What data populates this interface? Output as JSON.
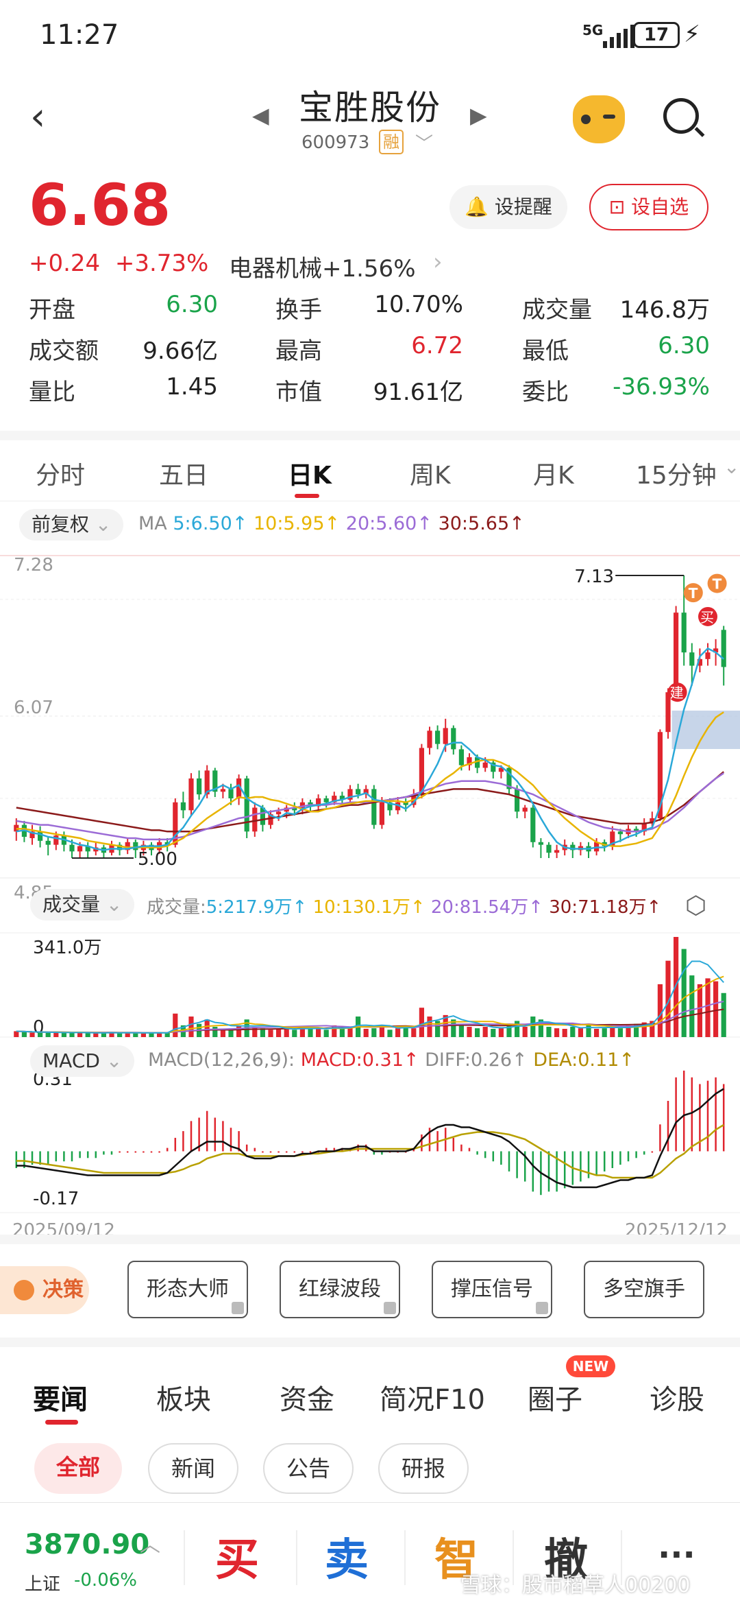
{
  "status": {
    "time": "11:27",
    "network": "5G",
    "battery": "17"
  },
  "header": {
    "title": "宝胜股份",
    "code": "600973",
    "rong": "融",
    "back_icon": "back-arrow-icon",
    "mascot_icon": "mascot-icon",
    "search_icon": "search-icon"
  },
  "quote": {
    "price": "6.68",
    "change": "+0.24",
    "pct": "+3.73%",
    "sector": "电器机械+1.56%",
    "alert_btn": "设提醒",
    "fav_btn": "设自选",
    "stats": [
      {
        "k": "开盘",
        "v": "6.30",
        "c": "green"
      },
      {
        "k": "换手",
        "v": "10.70%",
        "c": "dark"
      },
      {
        "k": "成交量",
        "v": "146.8万",
        "c": "dark"
      },
      {
        "k": "成交额",
        "v": "9.66亿",
        "c": "dark"
      },
      {
        "k": "最高",
        "v": "6.72",
        "c": "red"
      },
      {
        "k": "最低",
        "v": "6.30",
        "c": "green"
      },
      {
        "k": "量比",
        "v": "1.45",
        "c": "dark"
      },
      {
        "k": "市值",
        "v": "91.61亿",
        "c": "dark"
      },
      {
        "k": "委比",
        "v": "-36.93%",
        "c": "green"
      }
    ]
  },
  "tabs": [
    "分时",
    "五日",
    "日K",
    "周K",
    "月K",
    "15分钟"
  ],
  "active_tab": "日K",
  "indicators": {
    "fq": "前复权",
    "ma_label": "MA",
    "ma5": "5:6.50↑",
    "ma10": "10:5.95↑",
    "ma20": "20:5.60↑",
    "ma30": "30:5.65↑",
    "vol_btn": "成交量",
    "vol_label": "成交量:",
    "vol5": "5:217.9万↑",
    "vol10": "10:130.1万↑",
    "vol20": "20:81.54万↑",
    "vol30": "30:71.18万↑",
    "macd_btn": "MACD",
    "macd_params": "MACD(12,26,9):",
    "macd": "MACD:0.31↑",
    "diff": "DIFF:0.26↑",
    "dea": "DEA:0.11↑"
  },
  "chart_data": {
    "type": "candlestick",
    "price_axis": {
      "top": "7.28",
      "mid": "6.07",
      "bottom": "4.85"
    },
    "annotations": {
      "high": "7.13",
      "low": "5.00",
      "buy": "买",
      "build": "建",
      "t": "T"
    },
    "volume_axis": {
      "top": "341.0万",
      "zero": "0"
    },
    "macd_axis": {
      "top": "0.31",
      "bottom": "-0.17"
    },
    "x_start": "2025/09/12",
    "x_end": "2025/12/12",
    "colors": {
      "up": "#e0252e",
      "down": "#1aa34a",
      "ma5": "#2aa8d8",
      "ma10": "#e8b400",
      "ma20": "#9b6bd6",
      "ma30": "#8b1a1a"
    },
    "candles": [
      [
        5.2,
        5.25,
        5.13,
        5.3
      ],
      [
        5.25,
        5.16,
        5.12,
        5.28
      ],
      [
        5.15,
        5.2,
        5.1,
        5.25
      ],
      [
        5.2,
        5.13,
        5.08,
        5.24
      ],
      [
        5.13,
        5.1,
        5.02,
        5.16
      ],
      [
        5.1,
        5.17,
        5.06,
        5.2
      ],
      [
        5.17,
        5.1,
        5.05,
        5.2
      ],
      [
        5.1,
        5.05,
        5.0,
        5.14
      ],
      [
        5.05,
        5.09,
        5.0,
        5.12
      ],
      [
        5.09,
        5.05,
        5.0,
        5.12
      ],
      [
        5.05,
        5.08,
        5.02,
        5.12
      ],
      [
        5.08,
        5.04,
        5.0,
        5.1
      ],
      [
        5.04,
        5.1,
        5.02,
        5.13
      ],
      [
        5.1,
        5.06,
        5.02,
        5.12
      ],
      [
        5.06,
        5.12,
        5.03,
        5.15
      ],
      [
        5.12,
        5.06,
        5.0,
        5.14
      ],
      [
        5.06,
        5.1,
        5.02,
        5.13
      ],
      [
        5.1,
        5.06,
        5.02,
        5.12
      ],
      [
        5.06,
        5.12,
        5.03,
        5.15
      ],
      [
        5.12,
        5.1,
        5.05,
        5.15
      ],
      [
        5.1,
        5.42,
        5.08,
        5.45
      ],
      [
        5.42,
        5.36,
        5.3,
        5.5
      ],
      [
        5.36,
        5.6,
        5.32,
        5.64
      ],
      [
        5.6,
        5.48,
        5.44,
        5.66
      ],
      [
        5.48,
        5.66,
        5.45,
        5.7
      ],
      [
        5.66,
        5.5,
        5.46,
        5.68
      ],
      [
        5.5,
        5.52,
        5.45,
        5.56
      ],
      [
        5.52,
        5.45,
        5.4,
        5.56
      ],
      [
        5.45,
        5.6,
        5.4,
        5.63
      ],
      [
        5.6,
        5.2,
        5.15,
        5.62
      ],
      [
        5.2,
        5.38,
        5.16,
        5.42
      ],
      [
        5.38,
        5.25,
        5.2,
        5.4
      ],
      [
        5.25,
        5.33,
        5.22,
        5.36
      ],
      [
        5.33,
        5.35,
        5.28,
        5.38
      ],
      [
        5.35,
        5.38,
        5.3,
        5.4
      ],
      [
        5.38,
        5.36,
        5.32,
        5.42
      ],
      [
        5.36,
        5.42,
        5.33,
        5.45
      ],
      [
        5.42,
        5.39,
        5.35,
        5.44
      ],
      [
        5.39,
        5.45,
        5.36,
        5.48
      ],
      [
        5.45,
        5.42,
        5.38,
        5.47
      ],
      [
        5.42,
        5.47,
        5.4,
        5.5
      ],
      [
        5.47,
        5.44,
        5.4,
        5.5
      ],
      [
        5.44,
        5.52,
        5.42,
        5.55
      ],
      [
        5.52,
        5.48,
        5.45,
        5.56
      ],
      [
        5.48,
        5.52,
        5.45,
        5.55
      ],
      [
        5.52,
        5.25,
        5.22,
        5.55
      ],
      [
        5.25,
        5.42,
        5.22,
        5.46
      ],
      [
        5.42,
        5.36,
        5.32,
        5.45
      ],
      [
        5.36,
        5.42,
        5.33,
        5.46
      ],
      [
        5.42,
        5.4,
        5.35,
        5.45
      ],
      [
        5.4,
        5.48,
        5.38,
        5.52
      ],
      [
        5.48,
        5.83,
        5.45,
        5.86
      ],
      [
        5.83,
        5.96,
        5.78,
        5.99
      ],
      [
        5.96,
        5.86,
        5.82,
        6.0
      ],
      [
        5.86,
        5.98,
        5.8,
        6.05
      ],
      [
        5.98,
        5.82,
        5.78,
        6.0
      ],
      [
        5.82,
        5.7,
        5.66,
        5.85
      ],
      [
        5.7,
        5.76,
        5.66,
        5.79
      ],
      [
        5.76,
        5.68,
        5.64,
        5.78
      ],
      [
        5.68,
        5.72,
        5.65,
        5.76
      ],
      [
        5.72,
        5.65,
        5.6,
        5.74
      ],
      [
        5.65,
        5.68,
        5.6,
        5.7
      ],
      [
        5.68,
        5.52,
        5.48,
        5.7
      ],
      [
        5.52,
        5.35,
        5.3,
        5.55
      ],
      [
        5.35,
        5.38,
        5.3,
        5.4
      ],
      [
        5.38,
        5.12,
        5.08,
        5.4
      ],
      [
        5.12,
        5.1,
        5.0,
        5.15
      ],
      [
        5.1,
        5.04,
        5.0,
        5.12
      ],
      [
        5.04,
        5.06,
        5.0,
        5.1
      ],
      [
        5.06,
        5.1,
        5.02,
        5.14
      ],
      [
        5.1,
        5.06,
        5.0,
        5.12
      ],
      [
        5.06,
        5.09,
        5.02,
        5.12
      ],
      [
        5.09,
        5.05,
        5.0,
        5.12
      ],
      [
        5.05,
        5.12,
        5.02,
        5.15
      ],
      [
        5.12,
        5.09,
        5.05,
        5.14
      ],
      [
        5.09,
        5.2,
        5.06,
        5.24
      ],
      [
        5.2,
        5.18,
        5.12,
        5.22
      ],
      [
        5.18,
        5.22,
        5.15,
        5.25
      ],
      [
        5.22,
        5.2,
        5.16,
        5.24
      ],
      [
        5.2,
        5.26,
        5.17,
        5.3
      ],
      [
        5.26,
        5.3,
        5.22,
        5.35
      ],
      [
        5.3,
        5.95,
        5.28,
        5.97
      ],
      [
        5.95,
        6.25,
        5.9,
        6.28
      ],
      [
        6.25,
        6.85,
        6.2,
        6.9
      ],
      [
        6.85,
        6.55,
        6.45,
        7.13
      ],
      [
        6.55,
        6.45,
        6.3,
        6.62
      ],
      [
        6.45,
        6.5,
        6.4,
        6.58
      ],
      [
        6.5,
        6.55,
        6.45,
        6.62
      ],
      [
        6.55,
        6.58,
        6.45,
        6.65
      ],
      [
        6.72,
        6.44,
        6.3,
        6.75
      ]
    ],
    "ma5": [
      5.2,
      5.21,
      5.19,
      5.18,
      5.16,
      5.15,
      5.14,
      5.12,
      5.1,
      5.09,
      5.07,
      5.06,
      5.07,
      5.07,
      5.07,
      5.08,
      5.09,
      5.09,
      5.09,
      5.1,
      5.17,
      5.23,
      5.32,
      5.4,
      5.5,
      5.52,
      5.55,
      5.52,
      5.55,
      5.45,
      5.41,
      5.38,
      5.32,
      5.3,
      5.34,
      5.33,
      5.37,
      5.39,
      5.4,
      5.41,
      5.43,
      5.44,
      5.46,
      5.47,
      5.49,
      5.44,
      5.43,
      5.41,
      5.4,
      5.37,
      5.42,
      5.5,
      5.6,
      5.71,
      5.85,
      5.87,
      5.87,
      5.82,
      5.76,
      5.74,
      5.7,
      5.69,
      5.64,
      5.58,
      5.5,
      5.41,
      5.3,
      5.2,
      5.12,
      5.08,
      5.07,
      5.07,
      5.07,
      5.08,
      5.08,
      5.11,
      5.13,
      5.16,
      5.18,
      5.21,
      5.23,
      5.39,
      5.59,
      5.87,
      6.12,
      6.31,
      6.52,
      6.58,
      6.55,
      6.5
    ],
    "ma10": [
      5.22,
      5.22,
      5.21,
      5.2,
      5.19,
      5.18,
      5.17,
      5.16,
      5.15,
      5.13,
      5.12,
      5.11,
      5.1,
      5.09,
      5.08,
      5.08,
      5.08,
      5.08,
      5.08,
      5.09,
      5.12,
      5.15,
      5.2,
      5.25,
      5.3,
      5.34,
      5.38,
      5.42,
      5.46,
      5.45,
      5.46,
      5.46,
      5.44,
      5.43,
      5.41,
      5.39,
      5.37,
      5.35,
      5.35,
      5.37,
      5.38,
      5.4,
      5.41,
      5.42,
      5.43,
      5.43,
      5.43,
      5.43,
      5.43,
      5.42,
      5.44,
      5.46,
      5.5,
      5.55,
      5.6,
      5.64,
      5.69,
      5.71,
      5.73,
      5.74,
      5.74,
      5.72,
      5.69,
      5.65,
      5.6,
      5.55,
      5.48,
      5.42,
      5.36,
      5.3,
      5.25,
      5.2,
      5.16,
      5.12,
      5.1,
      5.09,
      5.09,
      5.1,
      5.11,
      5.13,
      5.15,
      5.24,
      5.34,
      5.47,
      5.62,
      5.76,
      5.88,
      5.98,
      6.06,
      6.1
    ],
    "ma20": [
      5.28,
      5.27,
      5.26,
      5.25,
      5.25,
      5.24,
      5.23,
      5.22,
      5.21,
      5.2,
      5.19,
      5.18,
      5.17,
      5.16,
      5.15,
      5.15,
      5.14,
      5.14,
      5.14,
      5.14,
      5.15,
      5.16,
      5.18,
      5.2,
      5.22,
      5.24,
      5.26,
      5.28,
      5.3,
      5.31,
      5.33,
      5.34,
      5.35,
      5.36,
      5.37,
      5.38,
      5.39,
      5.4,
      5.4,
      5.4,
      5.41,
      5.41,
      5.42,
      5.42,
      5.42,
      5.43,
      5.43,
      5.44,
      5.45,
      5.46,
      5.48,
      5.5,
      5.52,
      5.54,
      5.56,
      5.57,
      5.58,
      5.58,
      5.58,
      5.58,
      5.57,
      5.56,
      5.54,
      5.52,
      5.5,
      5.48,
      5.45,
      5.42,
      5.39,
      5.36,
      5.33,
      5.3,
      5.27,
      5.25,
      5.23,
      5.22,
      5.21,
      5.2,
      5.2,
      5.21,
      5.22,
      5.25,
      5.28,
      5.33,
      5.38,
      5.44,
      5.5,
      5.55,
      5.6,
      5.64
    ],
    "ma30": [
      5.38,
      5.37,
      5.36,
      5.35,
      5.34,
      5.33,
      5.32,
      5.31,
      5.3,
      5.29,
      5.28,
      5.27,
      5.26,
      5.25,
      5.24,
      5.23,
      5.22,
      5.21,
      5.21,
      5.2,
      5.2,
      5.2,
      5.2,
      5.21,
      5.22,
      5.23,
      5.24,
      5.25,
      5.26,
      5.27,
      5.28,
      5.29,
      5.3,
      5.31,
      5.32,
      5.33,
      5.34,
      5.35,
      5.36,
      5.37,
      5.38,
      5.39,
      5.4,
      5.4,
      5.41,
      5.42,
      5.43,
      5.44,
      5.45,
      5.46,
      5.47,
      5.48,
      5.49,
      5.5,
      5.51,
      5.52,
      5.52,
      5.52,
      5.52,
      5.51,
      5.5,
      5.49,
      5.48,
      5.46,
      5.44,
      5.42,
      5.4,
      5.38,
      5.36,
      5.34,
      5.32,
      5.31,
      5.3,
      5.29,
      5.28,
      5.27,
      5.26,
      5.26,
      5.26,
      5.26,
      5.27,
      5.29,
      5.32,
      5.36,
      5.4,
      5.45,
      5.5,
      5.55,
      5.6,
      5.65
    ],
    "volume": [
      20,
      18,
      15,
      16,
      14,
      18,
      15,
      14,
      16,
      13,
      14,
      15,
      16,
      14,
      15,
      13,
      14,
      15,
      16,
      14,
      80,
      40,
      70,
      45,
      60,
      35,
      25,
      30,
      40,
      60,
      35,
      30,
      25,
      28,
      30,
      25,
      35,
      28,
      30,
      25,
      40,
      30,
      35,
      70,
      28,
      30,
      40,
      25,
      30,
      35,
      30,
      100,
      70,
      55,
      75,
      60,
      40,
      35,
      30,
      35,
      28,
      30,
      40,
      55,
      35,
      70,
      60,
      35,
      30,
      28,
      35,
      30,
      40,
      28,
      30,
      35,
      30,
      40,
      45,
      50,
      55,
      180,
      260,
      341,
      300,
      210,
      180,
      200,
      190,
      150
    ],
    "macd_hist": [
      -0.05,
      -0.05,
      -0.04,
      -0.04,
      -0.04,
      -0.03,
      -0.03,
      -0.03,
      -0.02,
      -0.02,
      -0.02,
      -0.01,
      -0.01,
      0,
      0,
      0,
      0,
      0,
      0,
      0.01,
      0.04,
      0.06,
      0.09,
      0.1,
      0.12,
      0.1,
      0.09,
      0.07,
      0.06,
      0.02,
      0.01,
      0,
      0,
      0,
      0,
      0,
      0,
      0,
      0,
      0.01,
      0.01,
      0.01,
      0.01,
      0.02,
      0.02,
      -0.01,
      -0.01,
      0,
      0,
      0,
      0.01,
      0.05,
      0.07,
      0.06,
      0.07,
      0.04,
      0.02,
      0.01,
      -0.01,
      -0.02,
      -0.03,
      -0.04,
      -0.06,
      -0.08,
      -0.09,
      -0.12,
      -0.13,
      -0.12,
      -0.12,
      -0.11,
      -0.1,
      -0.09,
      -0.08,
      -0.07,
      -0.06,
      -0.05,
      -0.04,
      -0.03,
      -0.02,
      -0.01,
      0,
      0.08,
      0.15,
      0.22,
      0.24,
      0.22,
      0.2,
      0.21,
      0.22,
      0.2
    ],
    "diff": [
      -0.06,
      -0.06,
      -0.065,
      -0.07,
      -0.075,
      -0.08,
      -0.085,
      -0.09,
      -0.095,
      -0.1,
      -0.1,
      -0.1,
      -0.1,
      -0.1,
      -0.1,
      -0.1,
      -0.1,
      -0.1,
      -0.1,
      -0.09,
      -0.06,
      -0.03,
      0.0,
      0.02,
      0.04,
      0.04,
      0.04,
      0.02,
      0.01,
      -0.02,
      -0.03,
      -0.03,
      -0.03,
      -0.02,
      -0.02,
      -0.02,
      -0.01,
      -0.01,
      0,
      0,
      0,
      0.01,
      0.01,
      0.02,
      0.02,
      0,
      0,
      0,
      0,
      0,
      0.01,
      0.05,
      0.08,
      0.1,
      0.11,
      0.11,
      0.1,
      0.1,
      0.09,
      0.08,
      0.07,
      0.06,
      0.04,
      0.01,
      -0.02,
      -0.06,
      -0.09,
      -0.11,
      -0.13,
      -0.14,
      -0.15,
      -0.15,
      -0.15,
      -0.15,
      -0.14,
      -0.13,
      -0.12,
      -0.12,
      -0.11,
      -0.11,
      -0.1,
      -0.02,
      0.05,
      0.12,
      0.15,
      0.16,
      0.18,
      0.21,
      0.24,
      0.26
    ],
    "dea": [
      -0.04,
      -0.04,
      -0.045,
      -0.05,
      -0.055,
      -0.06,
      -0.065,
      -0.07,
      -0.075,
      -0.08,
      -0.085,
      -0.09,
      -0.09,
      -0.09,
      -0.09,
      -0.09,
      -0.09,
      -0.09,
      -0.09,
      -0.09,
      -0.085,
      -0.075,
      -0.06,
      -0.05,
      -0.03,
      -0.02,
      -0.01,
      -0.01,
      -0.01,
      -0.02,
      -0.02,
      -0.02,
      -0.02,
      -0.02,
      -0.02,
      -0.02,
      -0.015,
      -0.01,
      -0.01,
      -0.005,
      0,
      0,
      0.005,
      0.01,
      0.01,
      0.01,
      0.01,
      0.01,
      0.01,
      0.01,
      0.01,
      0.02,
      0.03,
      0.04,
      0.05,
      0.06,
      0.07,
      0.075,
      0.08,
      0.08,
      0.08,
      0.075,
      0.07,
      0.06,
      0.05,
      0.03,
      0.01,
      -0.01,
      -0.03,
      -0.05,
      -0.07,
      -0.08,
      -0.09,
      -0.1,
      -0.1,
      -0.11,
      -0.11,
      -0.11,
      -0.11,
      -0.11,
      -0.11,
      -0.09,
      -0.06,
      -0.03,
      -0.01,
      0.02,
      0.04,
      0.06,
      0.09,
      0.11
    ]
  },
  "decision": {
    "label": "决策",
    "buttons": [
      "形态大师",
      "红绿波段",
      "撑压信号",
      "多空旗手"
    ]
  },
  "news_tabs": [
    "要闻",
    "板块",
    "资金",
    "简况F10",
    "圈子",
    "诊股"
  ],
  "news_badge": "NEW",
  "sub_tabs": [
    "全部",
    "新闻",
    "公告",
    "研报"
  ],
  "bottom": {
    "index_value": "3870.90",
    "index_name": "上证",
    "index_change": "-0.06%",
    "buy": "买",
    "sell": "卖",
    "smart": "智",
    "cancel": "撤",
    "more": "···"
  },
  "watermark": "雪球：股市稻草人00200"
}
